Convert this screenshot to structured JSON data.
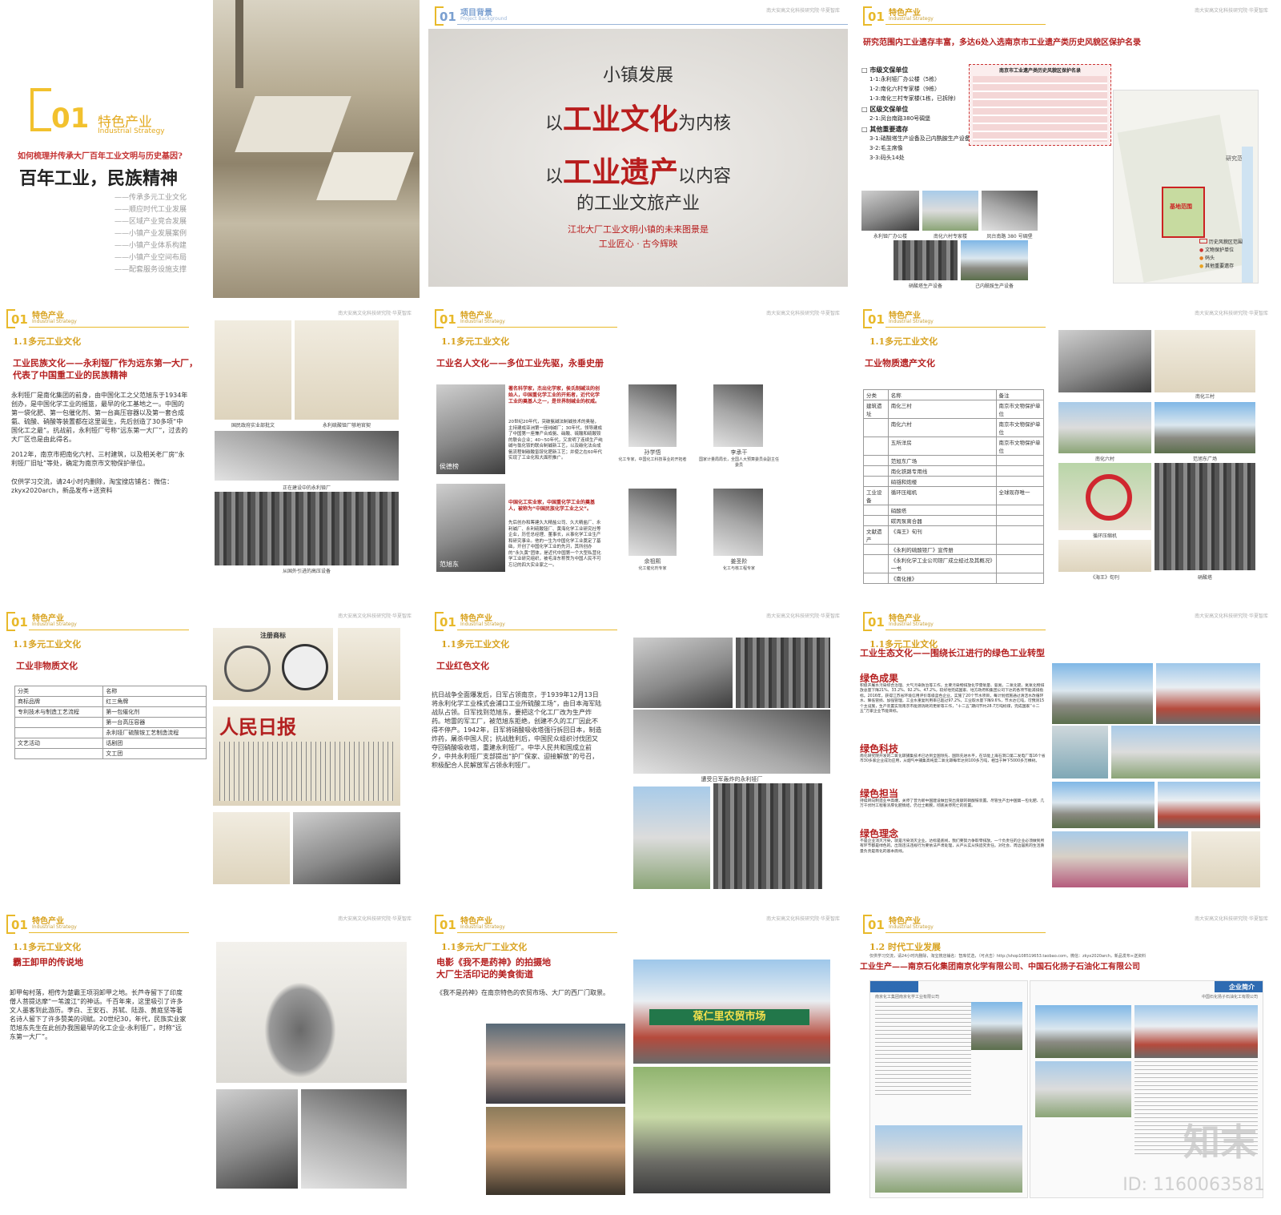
{
  "common": {
    "section_title": "特色产业",
    "section_sub": "Industrial Strategy",
    "num": "01",
    "org": "南大安高文化科技研究院·华夏智库"
  },
  "p1": {
    "num": "01",
    "title": "特色产业",
    "sub": "Industrial Strategy",
    "question": "如何梳理并传承大厂百年工业文明与历史基因?",
    "headline": "百年工业，民族精神",
    "items": [
      "——传承多元工业文化",
      "——顺应时代工业发展",
      "——区域产业竞合发展",
      "——小镇产业发展案例",
      "——小镇产业体系构建",
      "——小镇产业空间布局",
      "——配套服务设施支撑"
    ]
  },
  "p2": {
    "num": "01",
    "title": "项目背景",
    "sub": "Project Background",
    "line1": "小镇发展",
    "line2a": "以",
    "line2b": "工业文化",
    "line2c": "为内核",
    "line3a": "以",
    "line3b": "工业遗产",
    "line3c": "以内容",
    "line4": "的工业文旅产业",
    "tag1": "江北大厂工业文明小镇的未来图景是",
    "tag2": "工业匠心 · 古今辉映"
  },
  "p3": {
    "headline": "研究范围内工业遗存丰富，多达6处入选南京市工业遗产类历史风貌区保护名录",
    "g1": "市级文保单位",
    "g1_items": [
      "1-1:永利铔厂办公楼（5栋）",
      "1-2:南化六村专家楼（9栋）",
      "1-3:南化三村专家楼(1栋，已拆除)"
    ],
    "g2": "区级文保单位",
    "g2_items": [
      "2-1:凤台南路380号碉堡"
    ],
    "g3": "其他重要遗存",
    "g3_items": [
      "3-1:硝酸塔生产设备及己内酰胺生产设备",
      "3-2:毛主席像",
      "3-3:码头14处"
    ],
    "table_title": "南京市工业遗产类历史风貌区保护名录",
    "caps": [
      "永利铔厂办公楼",
      "南化六村专家楼",
      "凤台南路 380 号碉堡",
      "硝酸塔生产设备",
      "己内酰胺生产设备"
    ],
    "map_labels": [
      "研究范围",
      "基地范围"
    ],
    "legend": [
      "历史风貌区范围",
      "文物保护单位",
      "码头",
      "其他重要遗存"
    ]
  },
  "p4": {
    "sec": "1.1多元工业文化",
    "heading": "工业民族文化——永利铔厂作为远东第一大厂，代表了中国重工业的民族精神",
    "body": "永利铔厂是南化集团的前身，由中国化工之父范旭东于1934年创办，是中国化学工业的摇篮，最早的化工基地之一。中国的第一袋化肥、第一包催化剂、第一台高压容器以及第一套合成氨、硫酸、硝酸等装置都在这里诞生，先后创造了30多项“中国化工之最”。抗战前，永利铔厂号称“远东第一大厂”，过去的大厂区也是由此得名。",
    "body2": "2012年，南京市把南化六村、三村建筑，以及相关老厂房“永利铔厂旧址”等处，确定为南京市文物保护单位。",
    "body3": "仅供学习交流，请24小时内删除，淘宝搜店铺名：微信：zkyx2020arch，新品发布+送资料",
    "caps": [
      "国民政府实业部批文",
      "永利硫酸铔厂够地官契",
      "正在建设中的永利铔厂",
      "从国外引进的高压设备"
    ]
  },
  "p5": {
    "sec": "1.1多元工业文化",
    "heading": "工业名人文化——多位工业先驱，永垂史册",
    "hou_red": "著名科学家，杰出化学家，侯氏制碱法的创始人，中国重化学工业的开拓者，近代化学工业的奠基人之一，是世界制碱业的权威。",
    "hou_body": "20世纪20年代，突破氨碱法制碱技术的奥秘，主持建成亚洲第一座纯碱厂；30年代，领导建成了中国第一座兼产合成氨、硝酸、硫酸和硫酸铵的联合企业；40~50年代，又发明了连续生产纯碱与氯化铵的联合制碱新工艺，以及碳化法合成氨流程制碳酸氢铵化肥新工艺；并使之在60年代实现了工业化和大面积推广。",
    "fan_red": "中国化工实业家，中国重化学工业的奠基人，被称为“中国民族化学工业之父”。",
    "fan_body": "先后创办和筹建久大精盐公司、久大精盐厂、永利碱厂、永利硫酸铔厂、黄海化学工业研究社等企业，历任总经理、董事长，从事化学工业生产和研究事业。他的一生为中国化学工业奠定了基础，开创了中国化学工业的先河，其所创办的“永久黄”团体，是近代中国第一个大型私营化学工业研究组织，被毛泽东称赞为中国人民不可忘记的四大实业家之一。",
    "people": [
      {
        "name": "侯德榜",
        "desc": ""
      },
      {
        "name": "范旭东",
        "desc": ""
      },
      {
        "name": "孙学悟",
        "desc": "化工专家，中国化工科技事业的开拓者"
      },
      {
        "name": "李承干",
        "desc": "国家计量局局长，全国人大预算委员会副主任委员"
      },
      {
        "name": "余祖熙",
        "desc": "化工催化剂专家"
      },
      {
        "name": "姜圣阶",
        "desc": "化工与核工程专家"
      }
    ]
  },
  "p6": {
    "sec": "1.1多元工业文化",
    "heading": "工业物质遗产文化",
    "headers": [
      "分类",
      "名称",
      "备注"
    ],
    "rows": [
      [
        "建筑遗址",
        "南化三村",
        "南京市文物保护单位"
      ],
      [
        "",
        "南化六村",
        "南京市文物保护单位"
      ],
      [
        "",
        "五所洋房",
        "南京市文物保护单位"
      ],
      [
        "",
        "范旭东广场",
        ""
      ],
      [
        "",
        "南化铁路专用线",
        ""
      ],
      [
        "",
        "硝镪和炮楼",
        ""
      ],
      [
        "工业设备",
        "循环压缩机",
        "全球现存唯一"
      ],
      [
        "",
        "硝酸塔",
        ""
      ],
      [
        "",
        "碳丙泵离合器",
        ""
      ],
      [
        "文献遗产",
        "《海王》旬刊",
        ""
      ],
      [
        "",
        "《永利的硫酸铔厂》宣传册",
        ""
      ],
      [
        "",
        "《永利化学工业公司铔厂成立经过及其概况》一书",
        ""
      ],
      [
        "",
        "《南化报》",
        ""
      ]
    ],
    "caps": [
      "南化三村",
      "南化六村",
      "范旭东广场",
      "循环压缩机",
      "《海王》旬刊",
      "硝酸塔"
    ]
  },
  "p7": {
    "sec": "1.1多元工业文化",
    "heading": "工业非物质文化",
    "headers": [
      "分类",
      "名称"
    ],
    "rows": [
      [
        "商标品牌",
        "红三角牌"
      ],
      [
        "专利技术与制造工艺流程",
        "第一包催化剂"
      ],
      [
        "",
        "第一台高压容器"
      ],
      [
        "",
        "永利铔厂硫酸铵工艺制造流程"
      ],
      [
        "文艺活动",
        "话剧团"
      ],
      [
        "",
        "文工团"
      ]
    ],
    "newspaper": "人民日报",
    "trademark": "注册商标"
  },
  "p8": {
    "sec": "1.1多元工业文化",
    "heading": "工业红色文化",
    "body": "抗日战争全面爆发后，日军占领南京，于1939年12月13日将永利化学工业株式会浦口工业所硫酸工场”，由日本海军陆战队占领。日军找到范旭东，要把这个化工厂改为生产炸药。地雷的军工厂，被范旭东拒绝，创建不久的工厂因此不得不停产。1942年，日军将硝酸吸收塔强行拆回日本，制造炸药，屠杀中国人民；抗战胜利后，中国民众组织讨伐团又夺回硝酸吸收塔，重建永利铔厂。中华人民共和国成立前夕，中共永利铔厂支部提出“护厂保家、迎接解放”的号召，积极配合人民解放军占领永利铔厂。",
    "cap": "遭受日军轰炸的永利铔厂"
  },
  "p9": {
    "sec": "1.1多元工业文化",
    "heading": "工业生态文化——围绕长江进行的绿色工业转型",
    "blocks": [
      {
        "title": "绿色成果",
        "text": "积极开展水污染综合治理、大气污染防治等工作，主要污染物排放化学需氧量、氨氮、二氧化硫、氮氧化物排放总量下降21%、33.2%、92.2%、47.2%，较好地完成国家、地方政府和集团公司下达的各项节能减排指标。2016年，获得江苏省环境信用评价等级蓝色企业。实施了20个节水项目，每计划措施通过清洁水改循环水、降低管损、加强管理，工业水重复利用率已超过97.2%，工业取水量下降9.6%，节水达亿吨，可预测15个主设施，生产装置实现南京市能源消耗的更新等工作，“十二五”期间节约28.7万吨标煤，完成国家“十二五”万家企业节能目标。"
      },
      {
        "title": "绿色科技",
        "text": "南化研究院开发的二氧化碳捕集技术已达到全国领先、国际先进水平，在华能上海石洞口第二发电厂等16个省市30多家企业成功应用，从烟气中捕集高纯度二氧化碳每年达到100多万吨，相当于种下5000多万棵树。"
      },
      {
        "title": "绿色担当",
        "text": "持续转向制造业中高端，关停了曾为新中国建设做出突出贡献的硝酸铵装置。尽管生产出中国第一包化肥、几万千伏时工程看浓厚化肥情结，仍壮士断腕，彻底关停死亡的装置。"
      },
      {
        "title": "绿色理念",
        "text": "不是企业消灭污染，就是污染消灭企业。达标是底线，我们要努力争取零排放。一个负责任的企业必须做到所有环节都是绿色的。出现违法违规行为要依法严肃处理，从严从实从快追究责任。对社会、周边居民的生活质量负责是南化的基本底线。"
      }
    ]
  },
  "p10": {
    "sec": "1.1多元工业文化",
    "heading": "霸王卸甲的传说地",
    "body": "卸甲甸村落，相传为楚霸王项羽卸甲之地。长芦寺留下了印度僧人菩提达摩“一苇渡江”的神话。千百年来，这里吸引了许多文人墨客到此游历。李白、王安石、苏轼、陆游、黄庭坚等著名诗人留下了许多赞美的词赋。20世纪30，年代，民族实业家范旭东先生在此创办我国最早的化工企业-永利铔厂，时称“远东第一大厂”。"
  },
  "p11": {
    "sec": "1.1多元大厂工业文化",
    "heading1": "电影《我不是药神》的拍摄地",
    "heading2": "大厂生活印记的美食街道",
    "body": "《我不是药神》在南京特色的农贸市场、大厂的西厂门取景。",
    "sign": "葆仁里农贸市场"
  },
  "p12": {
    "sec": "1.2 时代工业发展",
    "top_note": "仅供学习交流，请24小时内删除，淘宝搜店铺名：智库优选，（可点击）http://shop108519653.taobao.com，微信：zkyx2020arch，新品发布+送资料",
    "heading": "工业生产——南京石化集团南京化学有限公司、中国石化扬子石油化工有限公司",
    "intro_left": "企业简介",
    "intro_right": "企业简介",
    "sub_left": "南京化工集团南京化学工业有限公司",
    "sub_right": "中国石化扬子石油化工有限公司"
  },
  "watermark": {
    "brand": "知末",
    "id": "ID: 1160063581"
  }
}
